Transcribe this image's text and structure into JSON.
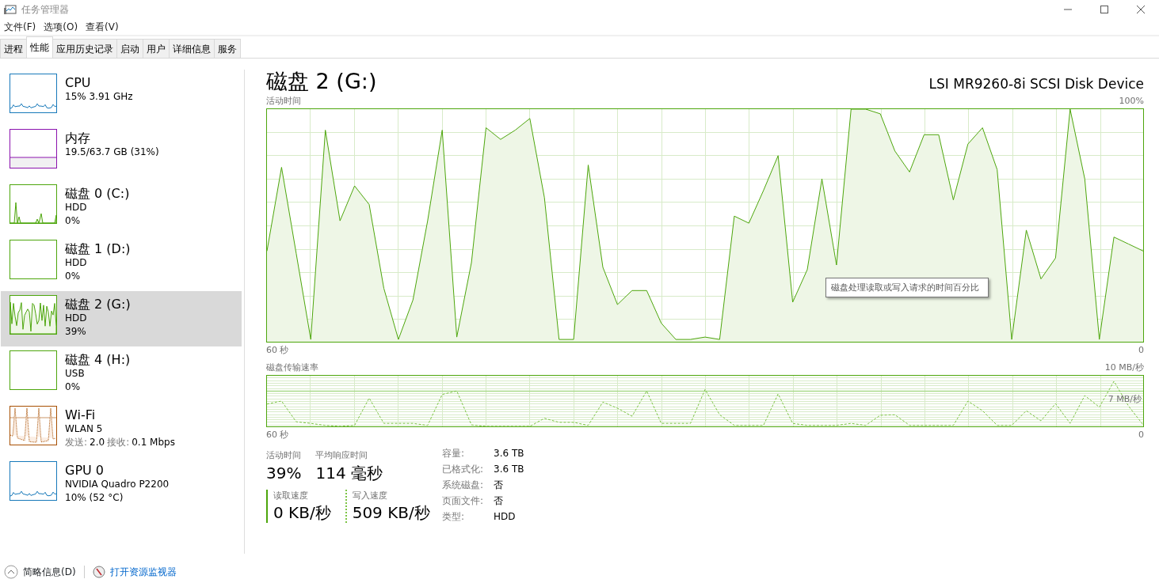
{
  "window": {
    "title": "任务管理器"
  },
  "menu": [
    "文件(F)",
    "选项(O)",
    "查看(V)"
  ],
  "tabs": [
    {
      "label": "进程",
      "selected": false
    },
    {
      "label": "性能",
      "selected": true
    },
    {
      "label": "应用历史记录",
      "selected": false
    },
    {
      "label": "启动",
      "selected": false
    },
    {
      "label": "用户",
      "selected": false
    },
    {
      "label": "详细信息",
      "selected": false
    },
    {
      "label": "服务",
      "selected": false
    }
  ],
  "sidebar": {
    "items": [
      {
        "name": "CPU",
        "lines": [
          "15% 3.91 GHz"
        ],
        "color": "#1779ba",
        "kind": "low",
        "selected": false
      },
      {
        "name": "内存",
        "lines": [
          "19.5/63.7 GB (31%)"
        ],
        "color": "#8b12ae",
        "kind": "meter",
        "selected": false
      },
      {
        "name": "磁盘 0 (C:)",
        "lines": [
          "HDD",
          "0%"
        ],
        "color": "#4da60c",
        "kind": "sparse",
        "selected": false
      },
      {
        "name": "磁盘 1 (D:)",
        "lines": [
          "HDD",
          "0%"
        ],
        "color": "#4da60c",
        "kind": "flat",
        "selected": false
      },
      {
        "name": "磁盘 2 (G:)",
        "lines": [
          "HDD",
          "39%"
        ],
        "color": "#4da60c",
        "kind": "dense",
        "selected": true
      },
      {
        "name": "磁盘 4 (H:)",
        "lines": [
          "USB",
          "0%"
        ],
        "color": "#4da60c",
        "kind": "flat",
        "selected": false
      },
      {
        "name": "Wi-Fi",
        "lines": [
          "WLAN 5"
        ],
        "rates": [
          {
            "label": "发送:",
            "value": "2.0"
          },
          {
            "label": "接收:",
            "value": "0.1 Mbps"
          }
        ],
        "color": "#a74f01",
        "kind": "dotted",
        "selected": false
      },
      {
        "name": "GPU 0",
        "lines": [
          "NVIDIA Quadro P2200",
          "10% (52 °C)"
        ],
        "color": "#1779ba",
        "kind": "low",
        "selected": false
      }
    ]
  },
  "detail": {
    "title": "磁盘 2 (G:)",
    "device": "LSI MR9260-8i SCSI Disk Device",
    "activity_chart": {
      "max_label": "100%",
      "start_label": "60 秒",
      "end_label": "0",
      "title": "活动时间",
      "tooltip": "磁盘处理读取或写入请求的时间百分比"
    },
    "transfer_chart": {
      "max_label": "10 MB/秒",
      "start_label": "60 秒",
      "end_label": "0",
      "title": "磁盘传输速率",
      "scale_label": "7 MB/秒"
    },
    "metrics": [
      {
        "label": "活动时间",
        "value": "39%"
      },
      {
        "label": "平均响应时间",
        "value": "114 毫秒"
      }
    ],
    "speeds": [
      {
        "label": "读取速度",
        "value": "0 KB/秒",
        "kind": "solid"
      },
      {
        "label": "写入速度",
        "value": "509 KB/秒",
        "kind": "dashed"
      }
    ],
    "properties": [
      {
        "label": "容量:",
        "value": "3.6 TB"
      },
      {
        "label": "已格式化:",
        "value": "3.6 TB"
      },
      {
        "label": "系统磁盘:",
        "value": "否"
      },
      {
        "label": "页面文件:",
        "value": "否"
      },
      {
        "label": "类型:",
        "value": "HDD"
      }
    ]
  },
  "footer": {
    "summary": "简略信息(D)",
    "link": "打开资源监视器"
  }
}
